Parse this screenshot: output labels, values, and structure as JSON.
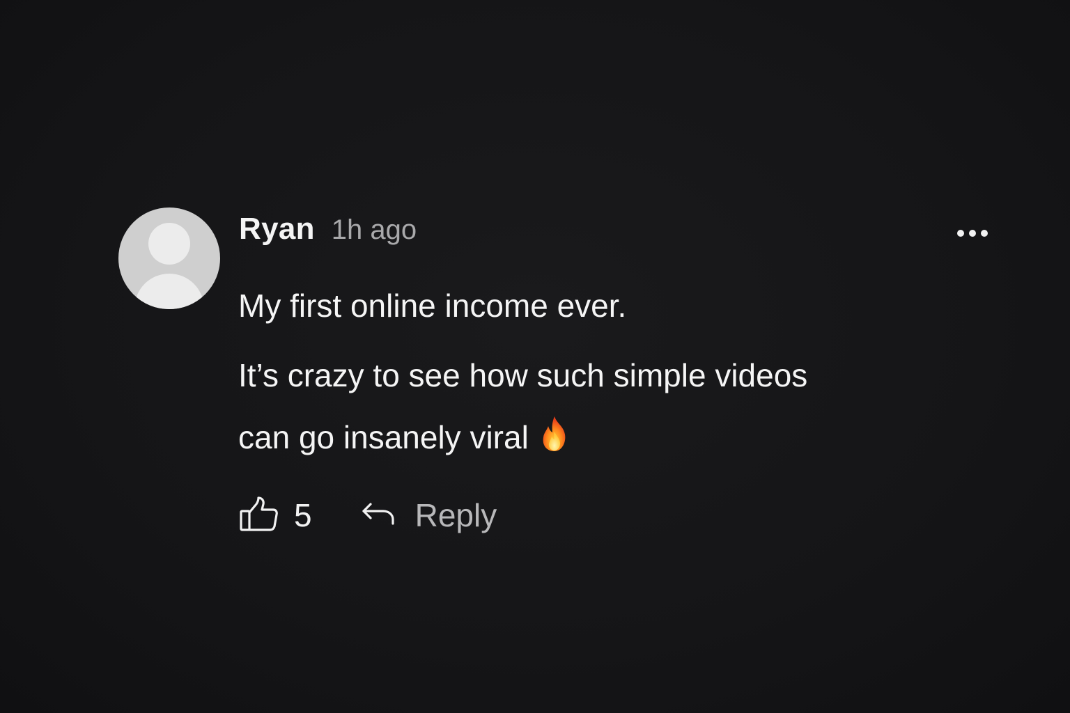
{
  "comment": {
    "author": "Ryan",
    "timestamp": "1h ago",
    "lines": [
      "My first online income ever.",
      "It’s crazy to see how such simple videos",
      "can go insanely viral"
    ],
    "emoji": "fire-emoji",
    "like_count": "5",
    "reply_label": "Reply"
  },
  "icons": {
    "like": "thumbs-up-icon",
    "reply": "reply-arrow-icon",
    "more": "more-horizontal-icon"
  },
  "colors": {
    "background": "#141416",
    "avatar": "#cfcfcf",
    "text": "#f5f5f5",
    "muted": "#a9a9ab"
  }
}
